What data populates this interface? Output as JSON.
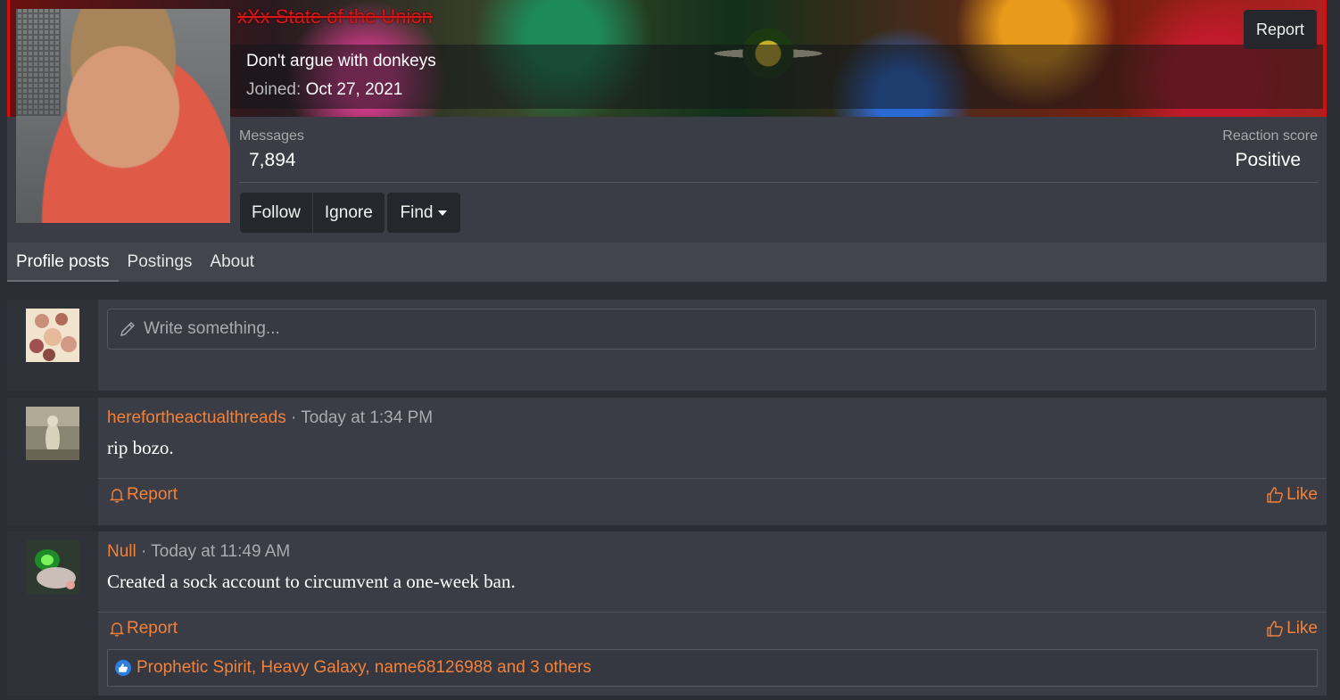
{
  "profile": {
    "user_title": "xXx State of the Union",
    "tagline": "Don't argue with donkeys",
    "joined_label": "Joined:",
    "joined_value": "Oct 27, 2021",
    "report_label": "Report",
    "messages_label": "Messages",
    "messages_value": "7,894",
    "reaction_label": "Reaction score",
    "reaction_value": "Positive",
    "buttons": {
      "follow": "Follow",
      "ignore": "Ignore",
      "find": "Find"
    }
  },
  "tabs": [
    {
      "label": "Profile posts",
      "active": true
    },
    {
      "label": "Postings",
      "active": false
    },
    {
      "label": "About",
      "active": false
    }
  ],
  "composer": {
    "placeholder": "Write something..."
  },
  "posts": [
    {
      "author": "herefortheactualthreads",
      "time": "· Today at 1:34 PM",
      "text": "rip bozo.",
      "report_label": "Report",
      "like_label": "Like"
    },
    {
      "author": "Null",
      "time": "· Today at 11:49 AM",
      "text": "Created a sock account to circumvent a one-week ban.",
      "report_label": "Report",
      "like_label": "Like",
      "likes_summary": "Prophetic Spirit, Heavy Galaxy, name68126988 and 3 others"
    }
  ],
  "colors": {
    "accent": "#f3813a",
    "page_bg": "#2b2e34",
    "card_bg": "#3a3d45",
    "like_badge": "#2d7ee0",
    "title_red": "#d81818"
  },
  "icons": {
    "composer": "pencil-icon",
    "report": "bell-icon",
    "like": "thumbs-up-icon",
    "find": "caret-down-icon"
  }
}
